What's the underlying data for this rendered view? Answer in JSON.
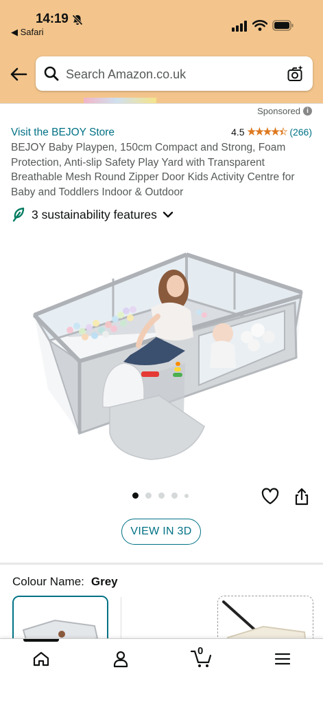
{
  "status_bar": {
    "time": "14:19",
    "back_app": "◀ Safari"
  },
  "search": {
    "placeholder": "Search Amazon.co.uk"
  },
  "sponsored": {
    "label": "Sponsored"
  },
  "product": {
    "store_link": "Visit the BEJOY Store",
    "rating_value": "4.5",
    "stars": "★★★★★",
    "rating_fraction": 0.9,
    "review_count": "(266)",
    "title": "BEJOY Baby Playpen, 150cm Compact and Strong, Foam Protection, Anti-slip Safety Play Yard with Transparent Breathable Mesh Round Zipper Door Kids Activity Centre for Baby and Toddlers Indoor & Outdoor",
    "sustainability": "3 sustainability features",
    "image_count": 5,
    "image_index": 1
  },
  "actions": {
    "view_3d": "VIEW IN 3D"
  },
  "variant": {
    "label": "Colour Name:",
    "value": "Grey"
  },
  "tabbar": {
    "cart_count": "0"
  },
  "colors": {
    "header_bg": "#f3c58c",
    "link": "#007185",
    "star": "#de7921"
  }
}
